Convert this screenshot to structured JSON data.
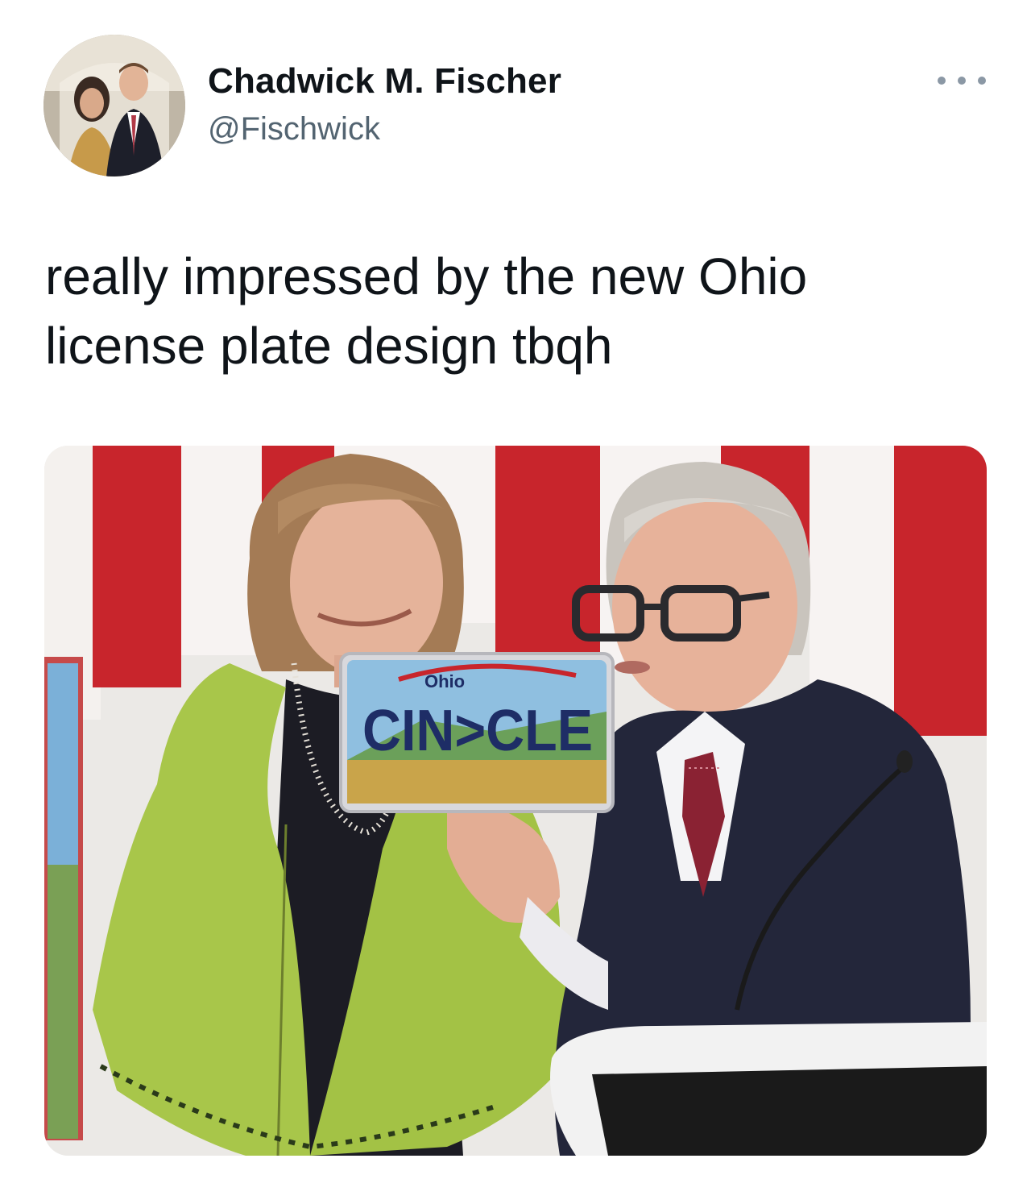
{
  "author": {
    "display_name": "Chadwick M. Fischer",
    "handle": "@Fischwick",
    "avatar_icon": "profile-photo-icon"
  },
  "more_menu": {
    "icon": "more-horizontal-icon"
  },
  "tweet": {
    "text": "really impressed by the new Ohio license plate design tbqh"
  },
  "media": {
    "plate": {
      "state_label": "Ohio",
      "plate_text": "CIN>CLE"
    },
    "colors": {
      "flag_red": "#c8252c",
      "flag_white": "#f7f3f2",
      "jacket_green": "#a8c64a",
      "suit_navy": "#23263a",
      "plate_text_navy": "#1e2d66",
      "podium_white": "#f2f2f2",
      "podium_black": "#1a1a1a"
    }
  }
}
